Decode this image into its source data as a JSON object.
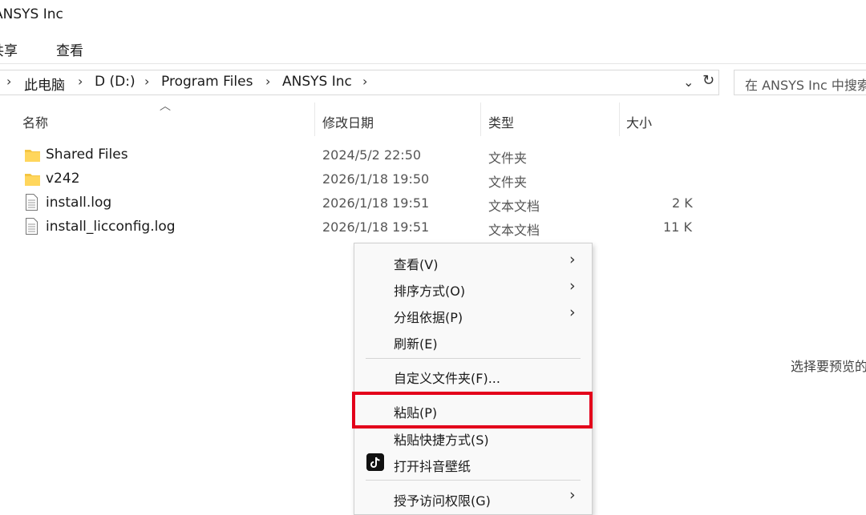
{
  "window": {
    "title": "ANSYS Inc"
  },
  "ribbon": {
    "tabs": [
      "共享",
      "查看"
    ]
  },
  "address_bar": {
    "crumbs": [
      "此电脑",
      "D (D:)",
      "Program Files",
      "ANSYS Inc"
    ],
    "search_placeholder": "在 ANSYS Inc 中搜索"
  },
  "columns": {
    "name": "名称",
    "modified": "修改日期",
    "type": "类型",
    "size": "大小"
  },
  "files": [
    {
      "name": "Shared Files",
      "modified": "2024/5/2 22:50",
      "type": "文件夹",
      "size": "",
      "icon": "folder-icon"
    },
    {
      "name": "v242",
      "modified": "2026/1/18 19:50",
      "type": "文件夹",
      "size": "",
      "icon": "folder-icon"
    },
    {
      "name": "install.log",
      "modified": "2026/1/18 19:51",
      "type": "文本文档",
      "size": "2 K",
      "icon": "text-file-icon"
    },
    {
      "name": "install_licconfig.log",
      "modified": "2026/1/18 19:51",
      "type": "文本文档",
      "size": "11 K",
      "icon": "text-file-icon"
    }
  ],
  "preview_pane": {
    "text": "选择要预览的文件。"
  },
  "context_menu": {
    "items": [
      {
        "label": "查看(V)",
        "submenu": true
      },
      {
        "label": "排序方式(O)",
        "submenu": true
      },
      {
        "label": "分组依据(P)",
        "submenu": true
      },
      {
        "label": "刷新(E)",
        "submenu": false
      },
      {
        "label": "自定义文件夹(F)...",
        "submenu": false
      },
      {
        "label": "粘贴(P)",
        "submenu": false,
        "highlighted": true
      },
      {
        "label": "粘贴快捷方式(S)",
        "submenu": false
      },
      {
        "label": "打开抖音壁纸",
        "submenu": false,
        "icon": "tiktok-icon"
      },
      {
        "label": "授予访问权限(G)",
        "submenu": true
      }
    ]
  },
  "colors": {
    "highlight_border": "#e3001b",
    "folder": "#f4c542",
    "menu_bg": "#f9f9f9"
  }
}
